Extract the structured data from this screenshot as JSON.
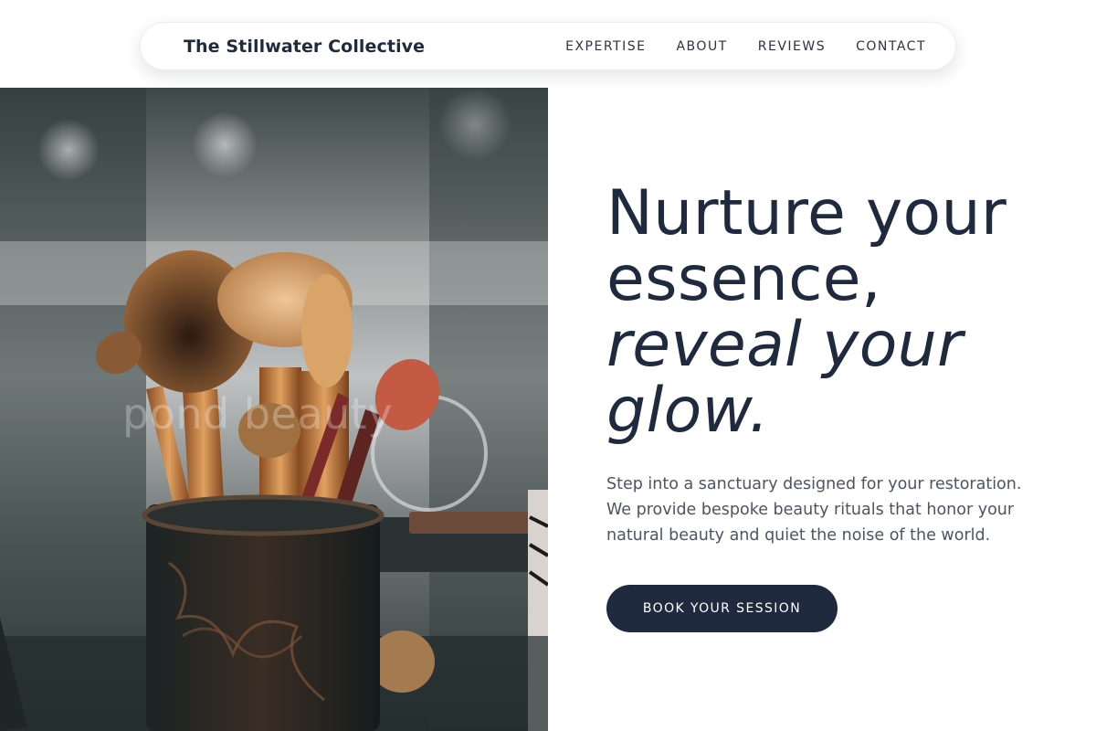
{
  "nav": {
    "brand": "The Stillwater Collective",
    "links": [
      {
        "label": "EXPERTISE"
      },
      {
        "label": "ABOUT"
      },
      {
        "label": "REVIEWS"
      },
      {
        "label": "CONTACT"
      }
    ]
  },
  "hero": {
    "image": {
      "subject": "makeup brushes in a cup",
      "watermark": "pond beauty"
    },
    "headline": {
      "line1": "Nurture your",
      "line2": "essence,",
      "line3": "reveal your",
      "line4": "glow."
    },
    "description": "Step into a sanctuary designed for your restoration. We provide bespoke beauty rituals that honor your natural beauty and quiet the noise of the world.",
    "cta_label": "BOOK YOUR SESSION"
  },
  "colors": {
    "primary": "#1f2a3f",
    "text_muted": "#4b5563",
    "background": "#ffffff"
  }
}
